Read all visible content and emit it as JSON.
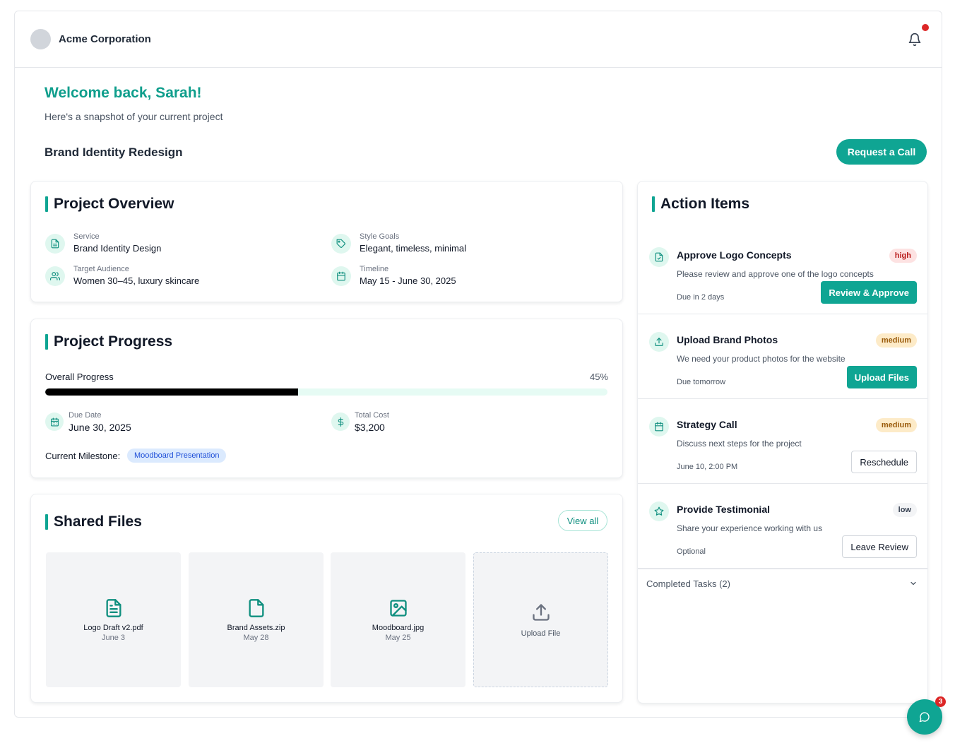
{
  "header": {
    "company": "Acme Corporation",
    "icons": [
      "avatar",
      "bell-icon"
    ]
  },
  "welcome": {
    "title": "Welcome back, Sarah!",
    "subtitle": "Here's a snapshot of your current project"
  },
  "project": {
    "name": "Brand Identity Redesign",
    "request_call_label": "Request a Call"
  },
  "overview": {
    "title": "Project Overview",
    "items": [
      {
        "label": "Service",
        "value": "Brand Identity Design",
        "icon": "document-icon"
      },
      {
        "label": "Style Goals",
        "value": "Elegant, timeless, minimal",
        "icon": "tag-icon"
      },
      {
        "label": "Target Audience",
        "value": "Women 30–45, luxury skincare",
        "icon": "users-icon"
      },
      {
        "label": "Timeline",
        "value": "May 15 - June 30, 2025",
        "icon": "calendar-icon"
      }
    ]
  },
  "progress": {
    "title": "Project Progress",
    "overall_label": "Overall Progress",
    "percent_text": "45%",
    "percent_value": 45,
    "due_label": "Due Date",
    "due_value": "June 30, 2025",
    "cost_label": "Total Cost",
    "cost_value": "$3,200",
    "milestone_label": "Current Milestone:",
    "milestone_value": "Moodboard Presentation"
  },
  "files": {
    "title": "Shared Files",
    "view_all_label": "View all",
    "items": [
      {
        "name": "Logo Draft v2.pdf",
        "date": "June 3",
        "icon": "file-text-icon"
      },
      {
        "name": "Brand Assets.zip",
        "date": "May 28",
        "icon": "file-icon"
      },
      {
        "name": "Moodboard.jpg",
        "date": "May 25",
        "icon": "image-icon"
      }
    ],
    "upload_label": "Upload File"
  },
  "actions": {
    "title": "Action Items",
    "items": [
      {
        "title": "Approve Logo Concepts",
        "priority": "high",
        "desc": "Please review and approve one of the logo concepts",
        "due": "Due in 2 days",
        "button": "Review & Approve",
        "icon": "file-check-icon"
      },
      {
        "title": "Upload Brand Photos",
        "priority": "medium",
        "desc": "We need your product photos for the website",
        "due": "Due tomorrow",
        "button": "Upload Files",
        "icon": "upload-icon"
      },
      {
        "title": "Strategy Call",
        "priority": "medium",
        "desc": "Discuss next steps for the project",
        "due": "June 10, 2:00 PM",
        "button": "Reschedule",
        "icon": "calendar-icon"
      },
      {
        "title": "Provide Testimonial",
        "priority": "low",
        "desc": "Share your experience working with us",
        "due": "Optional",
        "button": "Leave Review",
        "icon": "star-icon"
      }
    ],
    "completed_label": "Completed Tasks (2)"
  },
  "chat": {
    "count": "3"
  },
  "colors": {
    "accent": "#0fa593",
    "accent_text": "#0f9e8c",
    "danger": "#dc2626"
  }
}
